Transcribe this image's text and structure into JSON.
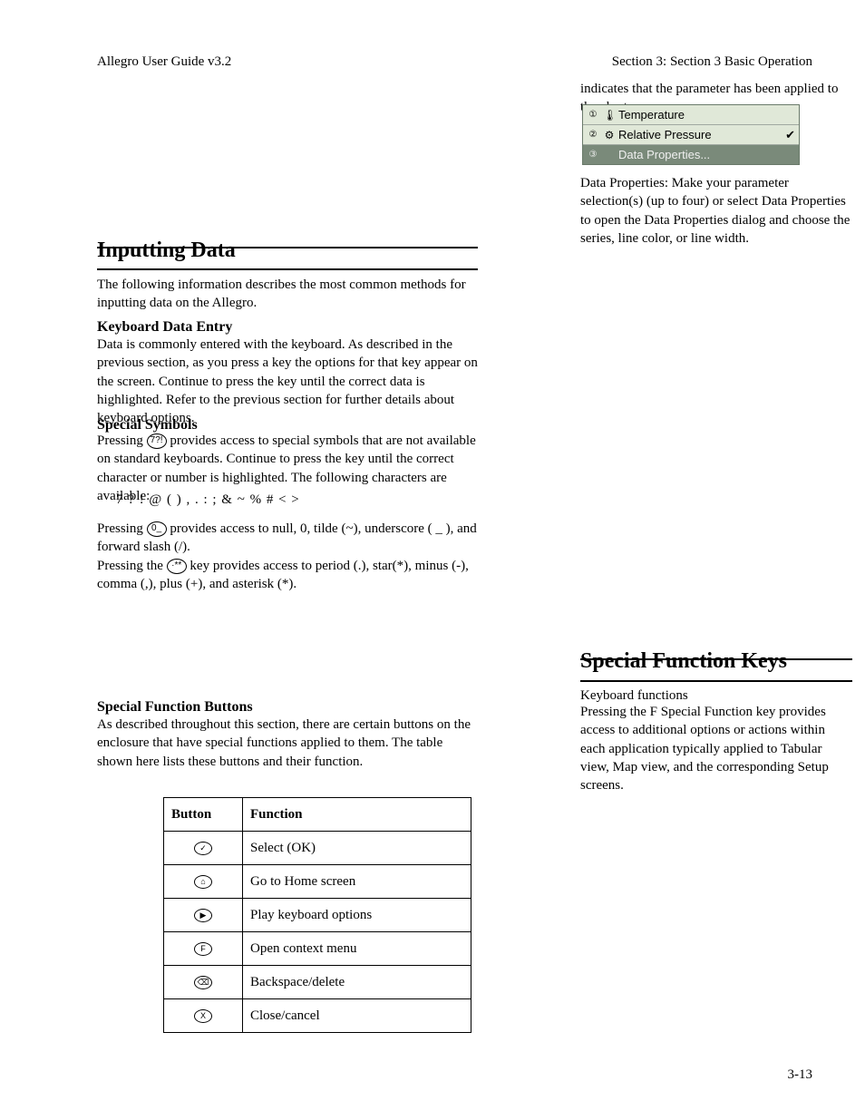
{
  "header": {
    "left": "Allegro User Guide v3.2",
    "right": "Section 3: Section 3 Basic Operation"
  },
  "p1": "indicates that the parameter has been applied to the chart.",
  "p2": "Data Properties: Make your parameter selection(s) (up to four) or select Data Properties to open the Data Properties dialog and choose the series, line color, or line width.",
  "menu": {
    "items": [
      {
        "num": "①",
        "icon": "🌡",
        "label": "Temperature",
        "checked": false
      },
      {
        "num": "②",
        "icon": "⚙",
        "label": "Relative Pressure",
        "checked": true
      },
      {
        "num": "③",
        "icon": "",
        "label": "Data Properties...",
        "checked": false
      }
    ]
  },
  "h1": "Inputting Data",
  "intro": "The following information describes the most common methods for inputting data on the Allegro.",
  "sub1": "Keyboard Data Entry",
  "sub1_body": "Data is commonly entered with the keyboard. As described in the previous section, as you press a key the options for that key appear on the screen. Continue to press the key until the correct data is highlighted. Refer to the previous section for further details about keyboard options.",
  "sub2": "Special Symbols",
  "sub2_body1_pre": "Pressing ",
  "sub2_body1_post": " provides access to special symbols that are not available on standard keyboards. Continue to press the key until the correct character or number is highlighted. The following characters are available:",
  "symbols": "7  ?  !  @  ( )  ,  .  :  ;  &  ~  %  #  <  >",
  "sub2_body2_pre": "Pressing ",
  "sub2_body2_post": " provides access to null, 0, tilde (~), underscore ( _ ), and forward slash (/).",
  "sub2_body3_pre": "Pressing the ",
  "sub2_body3_post": " key provides access to period (.), star(*), minus (-), comma (,), plus (+), and asterisk (*).",
  "sub3": "Special Function Buttons",
  "sub3_body": "As described throughout this section, there are certain buttons on the enclosure that have special functions applied to them. The table shown here lists these buttons and their function.",
  "table_h1": "Button",
  "table_h2": "Function",
  "rows": [
    {
      "k": "✓",
      "f": "Select (OK)"
    },
    {
      "k": "⌂",
      "f": "Go to Home screen"
    },
    {
      "k": "▶",
      "f": "Play keyboard options"
    },
    {
      "k": "F",
      "f": "Open context menu"
    },
    {
      "k": "⌫",
      "f": "Backspace/delete"
    },
    {
      "k": "X",
      "f": "Close/cancel"
    }
  ],
  "h2": "Special Function Keys",
  "h2sub": "Keyboard functions",
  "h2_body": "Pressing the F Special Function key provides access to additional options or actions within each application typically applied to Tabular view, Map view, and the corresponding Setup screens.",
  "footer": "3-13",
  "keycaps": {
    "seven": "7?!",
    "zero": "0_",
    "dot": "·**"
  }
}
